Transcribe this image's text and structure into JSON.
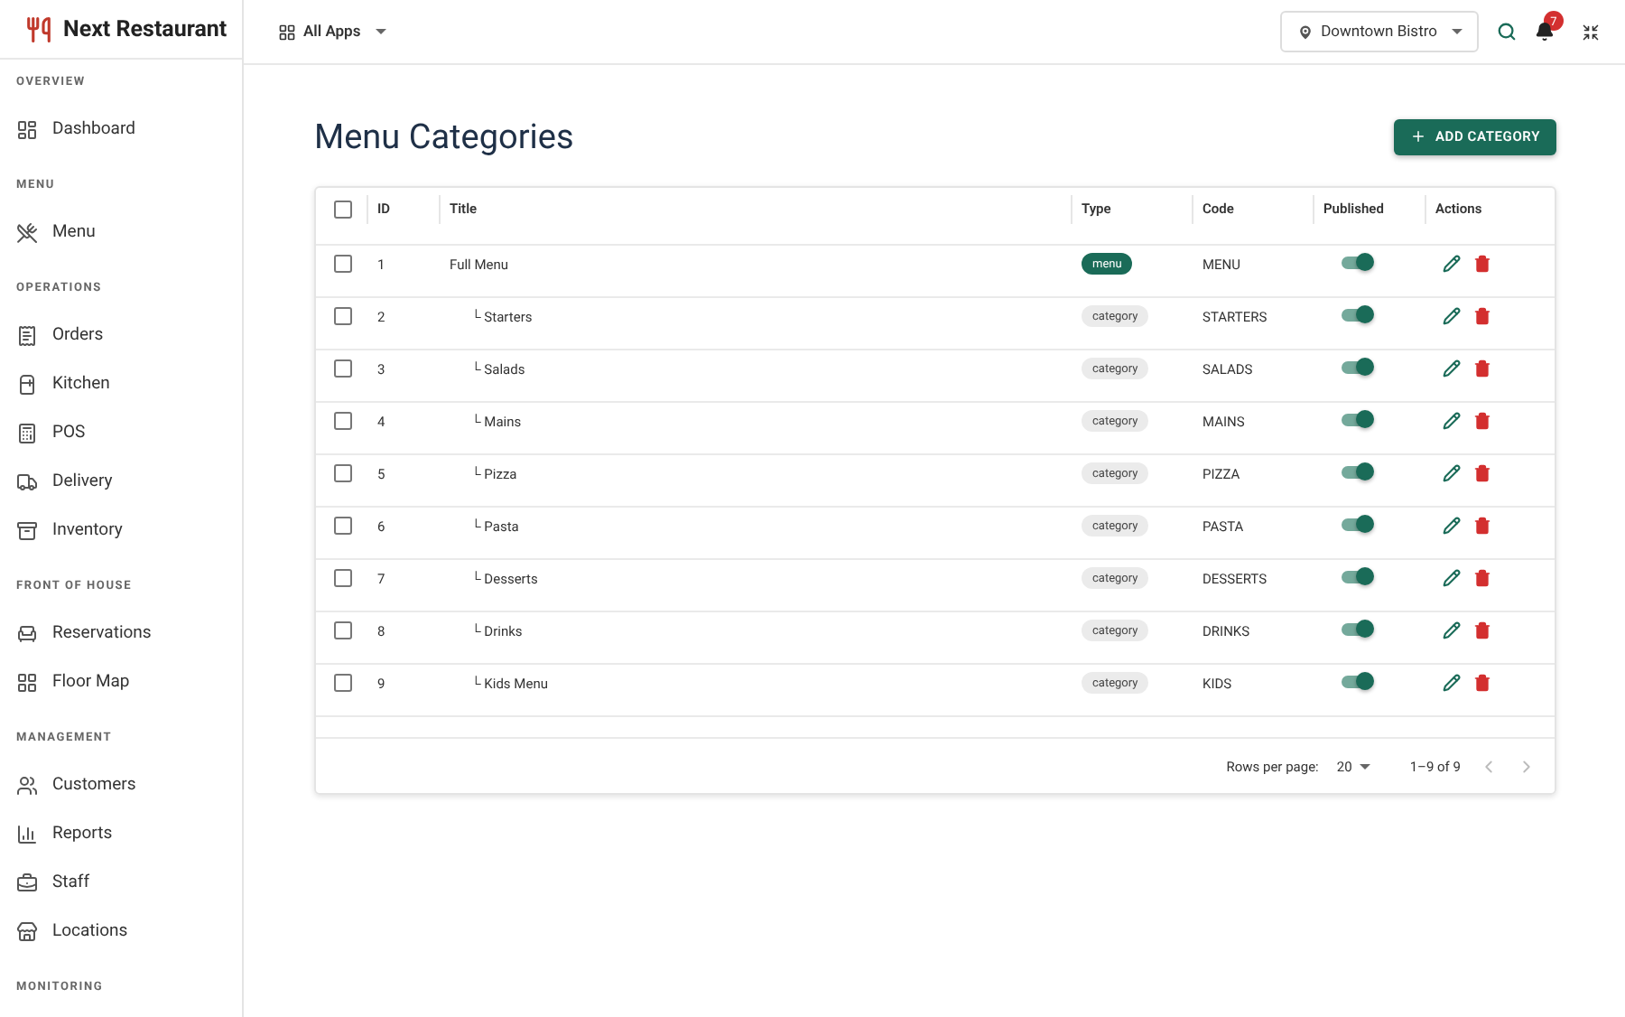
{
  "brand": {
    "name": "Next Restaurant"
  },
  "apps_menu": {
    "label": "All Apps"
  },
  "location_picker": {
    "label": "Downtown Bistro"
  },
  "notifications": {
    "count": "7"
  },
  "sidebar": {
    "sections": [
      {
        "title": "OVERVIEW",
        "items": [
          {
            "label": "Dashboard"
          }
        ]
      },
      {
        "title": "MENU",
        "items": [
          {
            "label": "Menu"
          }
        ]
      },
      {
        "title": "OPERATIONS",
        "items": [
          {
            "label": "Orders"
          },
          {
            "label": "Kitchen"
          },
          {
            "label": "POS"
          },
          {
            "label": "Delivery"
          },
          {
            "label": "Inventory"
          }
        ]
      },
      {
        "title": "FRONT OF HOUSE",
        "items": [
          {
            "label": "Reservations"
          },
          {
            "label": "Floor Map"
          }
        ]
      },
      {
        "title": "MANAGEMENT",
        "items": [
          {
            "label": "Customers"
          },
          {
            "label": "Reports"
          },
          {
            "label": "Staff"
          },
          {
            "label": "Locations"
          }
        ]
      },
      {
        "title": "MONITORING"
      }
    ]
  },
  "page": {
    "title": "Menu Categories",
    "add_button": "ADD CATEGORY"
  },
  "table": {
    "select_all": {
      "checked": false
    },
    "columns": [
      "ID",
      "Title",
      "Type",
      "Code",
      "Published",
      "Actions"
    ],
    "rows": [
      {
        "id": "1",
        "title": "Full Menu",
        "type": "menu",
        "code": "MENU",
        "published": true,
        "checked": false,
        "children": [
          {
            "id": "2",
            "title": "└ Starters",
            "type": "category",
            "code": "STARTERS",
            "published": true,
            "checked": false
          },
          {
            "id": "3",
            "title": "└ Salads",
            "type": "category",
            "code": "SALADS",
            "published": true,
            "checked": false
          },
          {
            "id": "4",
            "title": "└ Mains",
            "type": "category",
            "code": "MAINS",
            "published": true,
            "checked": false
          },
          {
            "id": "5",
            "title": "└ Pizza",
            "type": "category",
            "code": "PIZZA",
            "published": true,
            "checked": false
          },
          {
            "id": "6",
            "title": "└ Pasta",
            "type": "category",
            "code": "PASTA",
            "published": true,
            "checked": false
          },
          {
            "id": "7",
            "title": "└ Desserts",
            "type": "category",
            "code": "DESSERTS",
            "published": true,
            "checked": false
          },
          {
            "id": "8",
            "title": "└ Drinks",
            "type": "category",
            "code": "DRINKS",
            "published": true,
            "checked": false
          },
          {
            "id": "9",
            "title": "└ Kids Menu",
            "type": "category",
            "code": "KIDS",
            "published": true,
            "checked": false
          }
        ]
      }
    ],
    "pagination": {
      "rows_per_page_label": "Rows per page:",
      "rows_per_page": "20",
      "range": "1–9 of 9"
    }
  }
}
